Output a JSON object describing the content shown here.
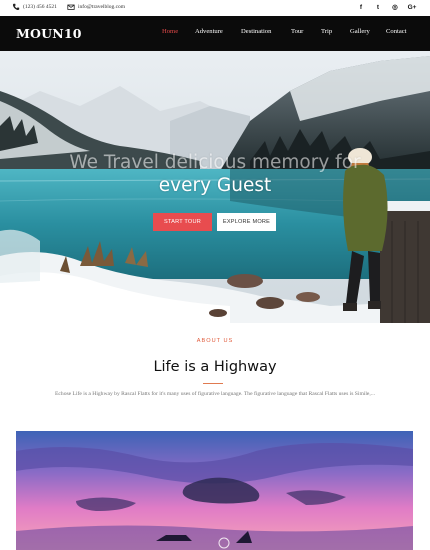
{
  "topbar": {
    "phone": "(123) 456 4521",
    "email": "info@travelblog.com",
    "phone_icon": "phone-icon",
    "email_icon": "envelope-icon",
    "socials": [
      {
        "name": "facebook-icon",
        "glyph": "f"
      },
      {
        "name": "twitter-icon",
        "glyph": "t"
      },
      {
        "name": "instagram-icon",
        "glyph": "◎"
      },
      {
        "name": "google-plus-icon",
        "glyph": "G+"
      }
    ]
  },
  "navbar": {
    "logo": "MOUN10",
    "items": [
      {
        "label": "Home",
        "active": true
      },
      {
        "label": "Adventure",
        "active": false
      },
      {
        "label": "Destination",
        "active": false
      },
      {
        "label": "Tour",
        "active": false
      },
      {
        "label": "Trip",
        "active": false
      },
      {
        "label": "Gallery",
        "active": false
      },
      {
        "label": "Contact",
        "active": false
      }
    ]
  },
  "hero": {
    "title_line1": "We Travel delicious memory for",
    "title_line2": "every Guest",
    "start_label": "START TOUR",
    "explore_label": "EXPLORE MORE"
  },
  "about": {
    "tag": "ABOUT US",
    "title": "Life is a Highway",
    "text": "Echose Life is a Highway by Rascal Flatts for it's many uses of figurative language. The figurative language that Rascal Flatts uses is Simile,..."
  },
  "colors": {
    "accent": "#e84c4f",
    "nav_bg": "#0b0b0b",
    "active_nav": "#e84b4b"
  }
}
